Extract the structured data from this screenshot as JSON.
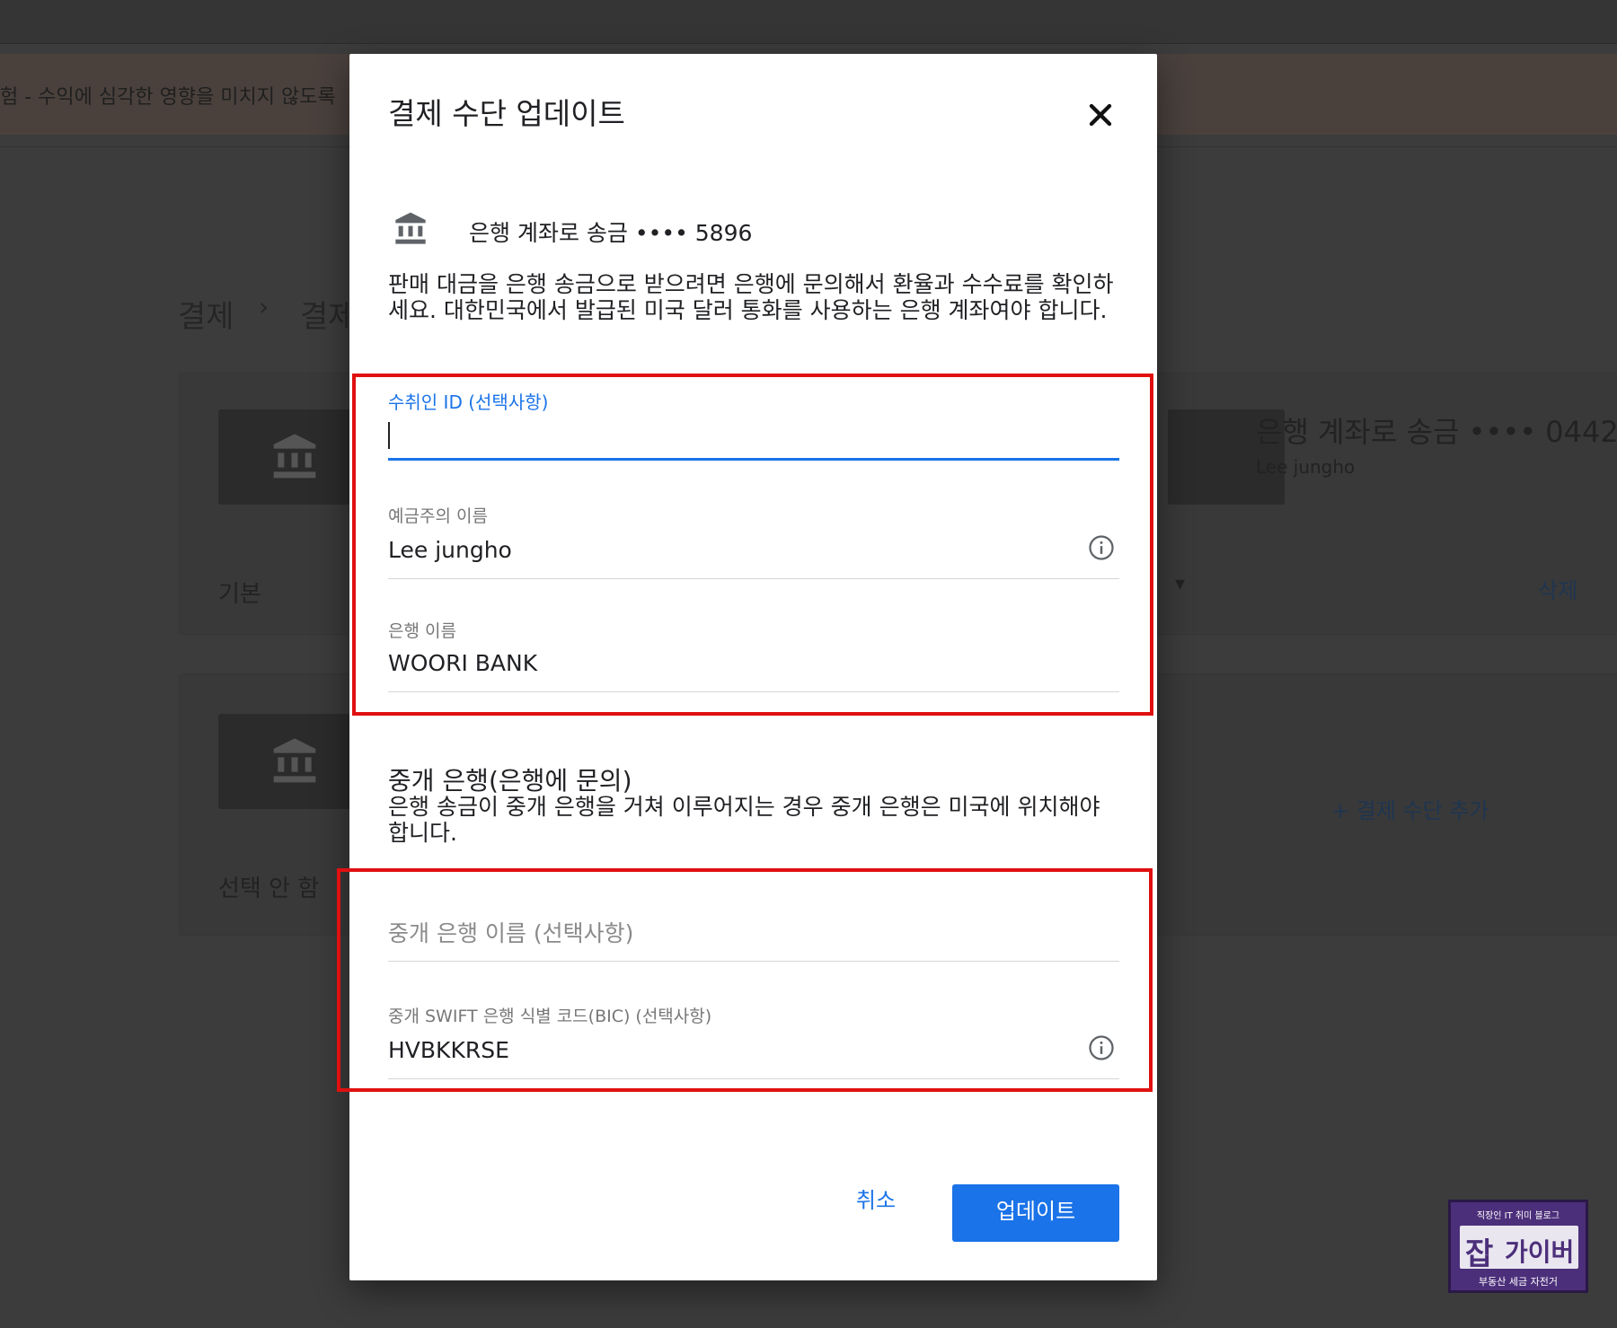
{
  "background": {
    "banner_text": "험 - 수익에 심각한 영향을 미치지 않도록",
    "breadcrumb": [
      "결제",
      "결제"
    ],
    "card1": {
      "account_label": "은행 계좌로 송금 •••• 0442",
      "holder": "Lee jungho",
      "status": "기본",
      "delete_label": "삭제"
    },
    "card2": {
      "status": "선택 안 함",
      "add_method_label": "+ 결제 수단 추가"
    }
  },
  "dialog": {
    "title": "결제 수단 업데이트",
    "account_label": "은행 계좌로 송금 •••• 5896",
    "description": "판매 대금을 은행 송금으로 받으려면 은행에 문의해서 환율과 수수료를 확인하세요. 대한민국에서 발급된 미국 달러 통화를 사용하는 은행 계좌여야 합니다.",
    "fields": {
      "recipient_id": {
        "label": "수취인 ID (선택사항)",
        "value": ""
      },
      "holder_name": {
        "label": "예금주의 이름",
        "value": "Lee jungho"
      },
      "bank_name": {
        "label": "은행 이름",
        "value": "WOORI BANK"
      }
    },
    "intermediary": {
      "title": "중개 은행(은행에 문의)",
      "description": "은행 송금이 중개 은행을 거쳐 이루어지는 경우 중개 은행은 미국에 위치해야 합니다.",
      "name_placeholder": "중개 은행 이름 (선택사항)",
      "swift": {
        "label": "중개 SWIFT 은행 식별 코드(BIC) (선택사항)",
        "value": "HVBKKRSE"
      }
    },
    "buttons": {
      "cancel": "취소",
      "update": "업데이트"
    }
  },
  "watermark": {
    "top": "직장인 IT 취미 블로그",
    "big": "잡",
    "name": "가이버",
    "bottom": "부동산 세금 자전거"
  },
  "colors": {
    "accent": "#1a73e8",
    "highlight": "#e01010",
    "overlay": "#3c3c3c"
  }
}
